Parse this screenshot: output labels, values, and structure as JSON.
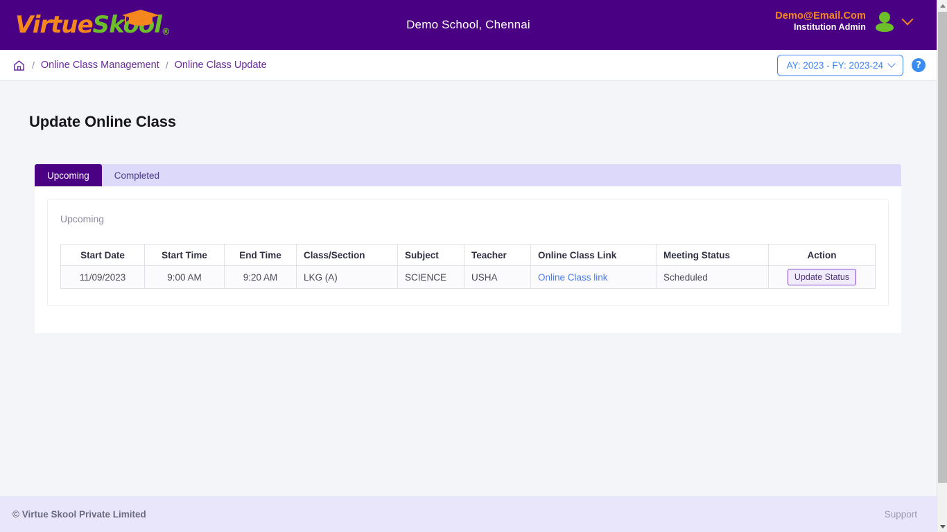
{
  "header": {
    "logo": {
      "part1": "Virtue",
      "part2": "Skool",
      "registered": "®",
      "cap_icon": "graduation-cap-icon"
    },
    "school_name": "Demo School, Chennai",
    "user": {
      "email": "Demo@Email.Com",
      "role": "Institution Admin",
      "avatar_icon": "user-avatar-icon",
      "chevron_icon": "chevron-down-icon"
    },
    "colors": {
      "bar_bg": "#4a0082",
      "email": "#f5871f",
      "logo_green": "#6cbe2a"
    }
  },
  "breadcrumb": {
    "home_icon": "home-icon",
    "separator": "/",
    "items": [
      {
        "label": "Online Class Management"
      },
      {
        "label": "Online Class Update"
      }
    ],
    "academic_year": {
      "label": "AY: 2023 - FY: 2023-24",
      "chevron_icon": "chevron-down-icon"
    },
    "help": {
      "glyph": "?",
      "icon": "help-question-icon"
    }
  },
  "main": {
    "page_title": "Update Online Class",
    "tabs": [
      {
        "label": "Upcoming",
        "active": true
      },
      {
        "label": "Completed",
        "active": false
      }
    ],
    "section_title": "Upcoming",
    "table": {
      "columns": [
        {
          "label": "Start Date",
          "align": "center"
        },
        {
          "label": "Start Time",
          "align": "center"
        },
        {
          "label": "End Time",
          "align": "center"
        },
        {
          "label": "Class/Section",
          "align": "left"
        },
        {
          "label": "Subject",
          "align": "left"
        },
        {
          "label": "Teacher",
          "align": "left"
        },
        {
          "label": "Online Class Link",
          "align": "left"
        },
        {
          "label": "Meeting Status",
          "align": "left"
        },
        {
          "label": "Action",
          "align": "center"
        }
      ],
      "rows": [
        {
          "start_date": "11/09/2023",
          "start_time": "9:00 AM",
          "end_time": "9:20 AM",
          "class_section": "LKG (A)",
          "subject": "SCIENCE",
          "teacher": "USHA",
          "online_class_link": "Online Class link",
          "meeting_status": "Scheduled",
          "action_label": "Update Status"
        }
      ]
    }
  },
  "footer": {
    "copyright": "© Virtue Skool Private Limited",
    "support": "Support"
  }
}
